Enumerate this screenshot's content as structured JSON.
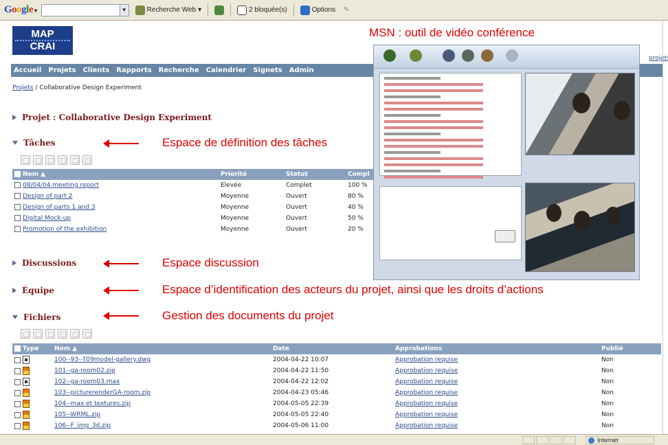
{
  "toolbar": {
    "google_logo": [
      "G",
      "o",
      "o",
      "g",
      "l",
      "e"
    ],
    "logo_arrow": "▾",
    "search_placeholder": "",
    "search_web": "Recherche Web",
    "blocked": "2 bloquée(s)",
    "options": "Options"
  },
  "app": {
    "logo_line1": "MAP",
    "logo_line2": "CRAI",
    "right_link": "projets"
  },
  "nav": [
    "Accueil",
    "Projets",
    "Clients",
    "Rapports",
    "Recherche",
    "Calendrier",
    "Signets",
    "Admin"
  ],
  "breadcrumb": {
    "link": "Projets",
    "sep": " / ",
    "current": "Collaborative Design Experiment"
  },
  "project_title": "Projet : Collaborative Design Experiment",
  "sections": {
    "tasks": "Tâches",
    "discussions": "Discussions",
    "team": "Équipe",
    "files": "Fichiers"
  },
  "tasks_table": {
    "headers": [
      "Nom ▲",
      "Priorité",
      "Statut",
      "Compl"
    ],
    "rows": [
      [
        "08/04/04 meeting report",
        "Elevée",
        "Complet",
        "100 %"
      ],
      [
        "Design of part 2",
        "Moyenne",
        "Ouvert",
        "80 %"
      ],
      [
        "Design of parts 1 and 3",
        "Moyenne",
        "Ouvert",
        "40 %"
      ],
      [
        "Digital Mock-up",
        "Moyenne",
        "Ouvert",
        "50 %"
      ],
      [
        "Promotion of the exhibition",
        "Moyenne",
        "Ouvert",
        "20 %"
      ]
    ]
  },
  "files_table": {
    "headers": [
      "Type",
      "Nom ▲",
      "Date",
      "Approbations",
      "Publié"
    ],
    "rows": [
      {
        "type": "doc",
        "name": "100--93--T09model-gallery.dwg",
        "date": "2004-04-22 10:07",
        "approval": "Approbation requise",
        "published": "Non"
      },
      {
        "type": "zip",
        "name": "101--ga-room02.zip",
        "date": "2004-04-22 11:50",
        "approval": "Approbation requise",
        "published": "Non"
      },
      {
        "type": "doc",
        "name": "102--ga-room03.max",
        "date": "2004-04-22 12:02",
        "approval": "Approbation requise",
        "published": "Non"
      },
      {
        "type": "zip",
        "name": "103--picturerenderGA-room.zip",
        "date": "2004-04-23 05:46",
        "approval": "Approbation requise",
        "published": "Non"
      },
      {
        "type": "zip",
        "name": "104--max et textures.zip",
        "date": "2004-05-05 22:39",
        "approval": "Approbation requise",
        "published": "Non"
      },
      {
        "type": "zip",
        "name": "105--WRML.zip",
        "date": "2004-05-05 22:40",
        "approval": "Approbation requise",
        "published": "Non"
      },
      {
        "type": "zip",
        "name": "106--F_img_3d.zip",
        "date": "2004-05-06 11:00",
        "approval": "Approbation requise",
        "published": "Non"
      }
    ]
  },
  "annotations": {
    "msn": "MSN : outil de vidéo conférence",
    "tasks": "Espace de définition des tâches",
    "discussion": "Espace discussion",
    "team": "Espace d’identification des acteurs du projet, ainsi que les droits d’actions",
    "files": "Gestion des documents du projet"
  },
  "statusbar": {
    "zone": "Internet"
  },
  "colors": {
    "nav": "#6786a6",
    "header_row": "#8aa1bd",
    "annotation": "#e00000",
    "section_title": "#7a1a1a"
  }
}
